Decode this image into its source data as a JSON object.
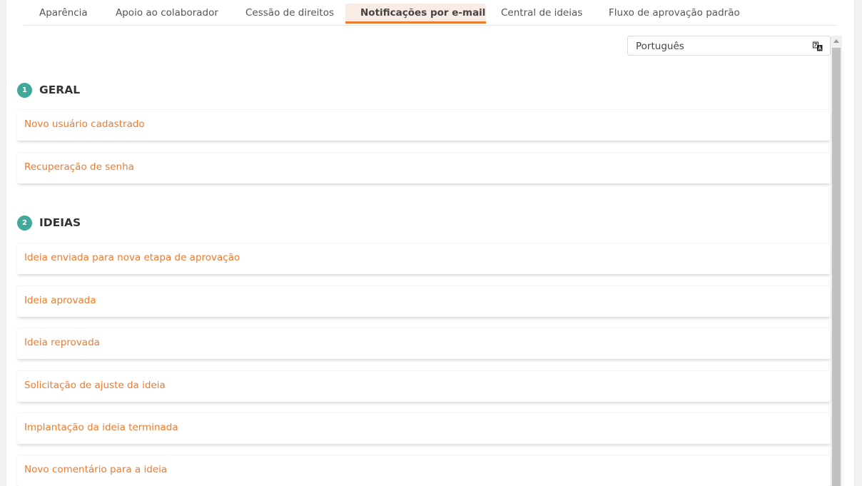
{
  "tabs": [
    {
      "label": "Aparência"
    },
    {
      "label": "Apoio ao colaborador"
    },
    {
      "label": "Cessão de direitos"
    },
    {
      "label": "Notificações por e-mail"
    },
    {
      "label": "Central de ideias"
    },
    {
      "label": "Fluxo de aprovação padrão"
    }
  ],
  "active_tab": "Notificações por e-mail",
  "language_select": {
    "value": "Português",
    "icon": "translate-icon"
  },
  "sections": [
    {
      "number": "1",
      "title": "GERAL",
      "items": [
        {
          "label": "Novo usuário cadastrado"
        },
        {
          "label": "Recuperação de senha"
        }
      ]
    },
    {
      "number": "2",
      "title": "IDEIAS",
      "items": [
        {
          "label": "Ideia enviada para nova etapa de aprovação"
        },
        {
          "label": "Ideia aprovada"
        },
        {
          "label": "Ideia reprovada"
        },
        {
          "label": "Solicitação de ajuste da ideia"
        },
        {
          "label": "Implantação da ideia terminada"
        },
        {
          "label": "Novo comentário para a ideia"
        }
      ]
    }
  ],
  "colors": {
    "accent": "#ef7a2c",
    "badge": "#41a89a",
    "active_tab_bg": "#f8ece4"
  }
}
